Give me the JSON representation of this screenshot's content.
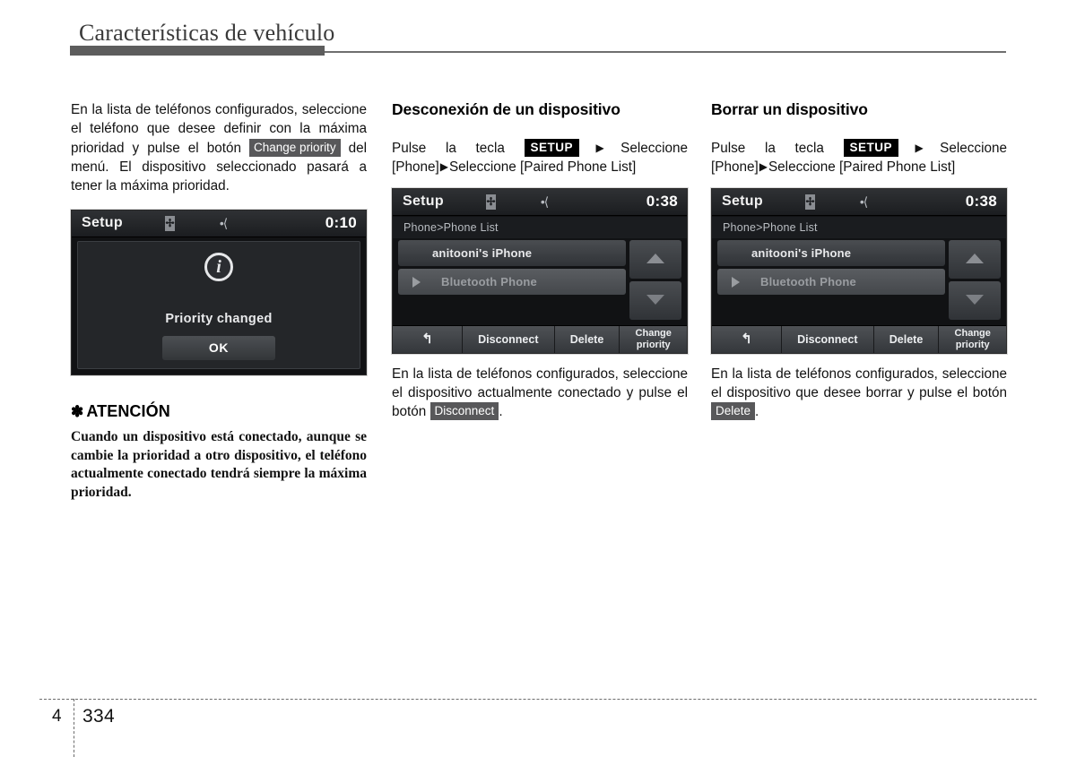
{
  "header": {
    "chapter_title": "Características de vehículo"
  },
  "footer": {
    "chapter_number": "4",
    "page_number": "334"
  },
  "columns": {
    "left": {
      "intro_part1": "En la lista de teléfonos configurados, seleccione el teléfono que desee definir con la máxima prioridad y pulse el botón",
      "chip_change_priority": "Change priority",
      "intro_part2": "del menú. El dispositivo seleccionado pasará a tener la máxima prioridad.",
      "device": {
        "statusbar_title": "Setup",
        "clock": "0:10",
        "bluetooth_icon": "bluetooth-icon",
        "usb_icon": "usb-icon",
        "info_icon": "i",
        "message": "Priority changed",
        "ok_label": "OK"
      },
      "caution": {
        "star": "✽",
        "heading": "ATENCIÓN",
        "text": "Cuando un dispositivo está conectado, aunque se cambie la prioridad a otro dispositivo, el teléfono actualmente conectado tendrá siempre la máxima prioridad."
      }
    },
    "middle": {
      "heading": "Desconexión de un dispositivo",
      "path_prefix": "Pulse la tecla",
      "chip_setup": "SETUP",
      "arrow": "▶",
      "path_step1": "Seleccione [Phone]",
      "path_step2": "Seleccione [Paired Phone List]",
      "device": {
        "statusbar_title": "Setup",
        "clock": "0:38",
        "bluetooth_icon": "bluetooth-icon",
        "usb_icon": "usb-icon",
        "breadcrumb": "Phone>Phone List",
        "list_items": [
          {
            "label": "anitooni's iPhone",
            "has_play_icon": false
          },
          {
            "label": "Bluetooth Phone",
            "has_play_icon": true
          }
        ],
        "scroll_up": "scroll-up-arrow",
        "scroll_down": "scroll-down-arrow",
        "toolbar": [
          {
            "label": "↰",
            "name": "back-button",
            "two_line": false
          },
          {
            "label": "Disconnect",
            "name": "disconnect-button",
            "two_line": false
          },
          {
            "label": "Delete",
            "name": "delete-button",
            "two_line": false
          },
          {
            "label": "Change\npriority",
            "name": "change-priority-button",
            "two_line": true
          }
        ]
      },
      "caption_part1": "En la lista de teléfonos configurados, seleccione el dispositivo actualmente conectado y pulse el botón",
      "chip_disconnect": "Disconnect",
      "caption_part2": "."
    },
    "right": {
      "heading": "Borrar un dispositivo",
      "path_prefix": "Pulse la tecla",
      "chip_setup": "SETUP",
      "arrow": "▶",
      "path_step1": "Seleccione [Phone]",
      "path_step2": "Seleccione [Paired Phone List]",
      "device": {
        "statusbar_title": "Setup",
        "clock": "0:38",
        "bluetooth_icon": "bluetooth-icon",
        "usb_icon": "usb-icon",
        "breadcrumb": "Phone>Phone List",
        "list_items": [
          {
            "label": "anitooni's iPhone",
            "has_play_icon": false
          },
          {
            "label": "Bluetooth Phone",
            "has_play_icon": true
          }
        ],
        "scroll_up": "scroll-up-arrow",
        "scroll_down": "scroll-down-arrow",
        "toolbar": [
          {
            "label": "↰",
            "name": "back-button",
            "two_line": false
          },
          {
            "label": "Disconnect",
            "name": "disconnect-button",
            "two_line": false
          },
          {
            "label": "Delete",
            "name": "delete-button",
            "two_line": false
          },
          {
            "label": "Change\npriority",
            "name": "change-priority-button",
            "two_line": true
          }
        ]
      },
      "caption_part1": "En la lista de teléfonos configurados, seleccione el dispositivo que desee borrar y pulse el botón",
      "chip_delete": "Delete",
      "caption_part2": "."
    }
  }
}
